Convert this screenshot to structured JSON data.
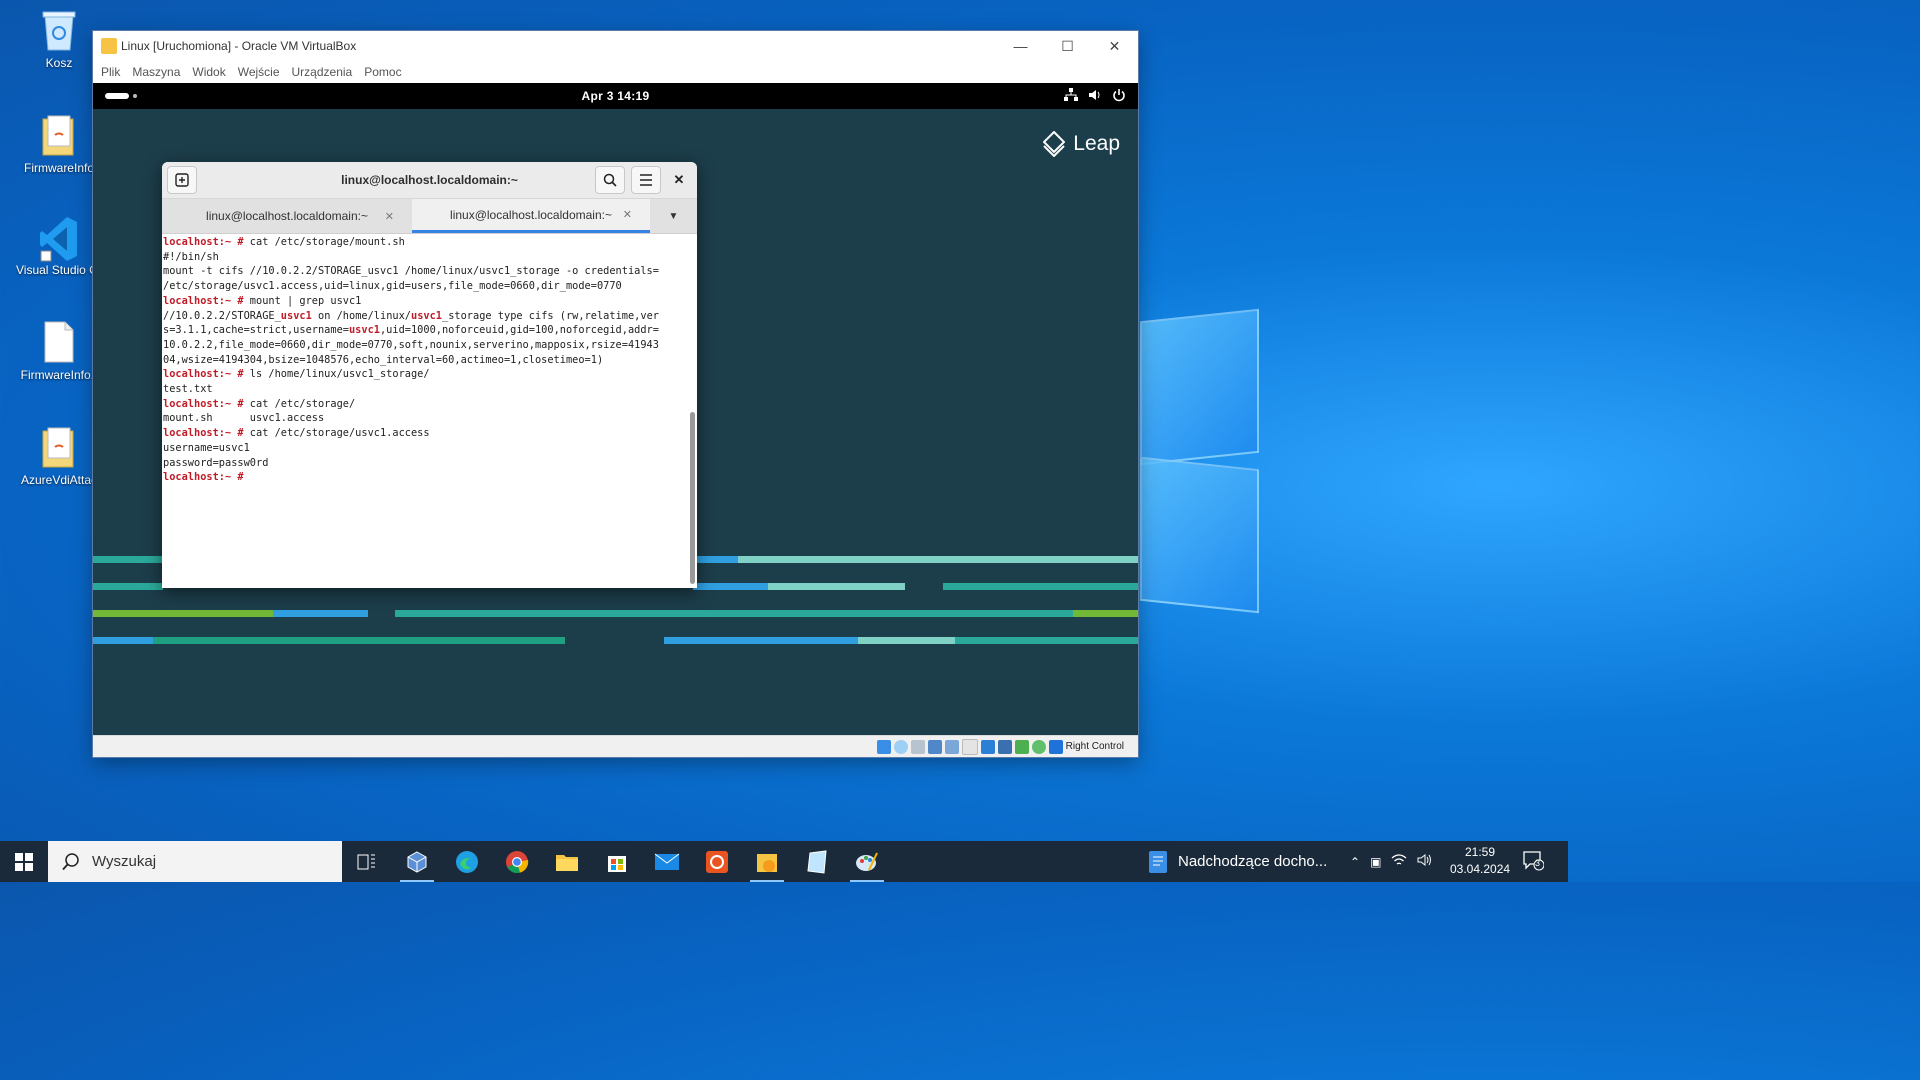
{
  "desktop": {
    "icons": [
      {
        "label": "Kosz"
      },
      {
        "label": "FirmwareInfo"
      },
      {
        "label": "Visual Studio Co"
      },
      {
        "label": "FirmwareInfo.t"
      },
      {
        "label": "AzureVdiAttac"
      }
    ]
  },
  "vbox": {
    "title": "Linux [Uruchomiona] - Oracle VM VirtualBox",
    "menu": [
      "Plik",
      "Maszyna",
      "Widok",
      "Wejście",
      "Urządzenia",
      "Pomoc"
    ],
    "host_key": "Right Control"
  },
  "gnome": {
    "clock": "Apr 3  14:19",
    "brand": "Leap"
  },
  "terminal": {
    "title": "linux@localhost.localdomain:~",
    "tabs": [
      {
        "label": "linux@localhost.localdomain:~"
      },
      {
        "label": "linux@localhost.localdomain:~"
      }
    ],
    "prompt": "localhost:~ #",
    "lines": {
      "l1_cmd": " cat /etc/storage/mount.sh",
      "l2": "#!/bin/sh",
      "l3": "mount -t cifs //10.0.2.2/STORAGE_usvc1 /home/linux/usvc1_storage -o credentials=",
      "l4": "/etc/storage/usvc1.access,uid=linux,gid=users,file_mode=0660,dir_mode=0770",
      "l5_cmd": " mount | grep usvc1",
      "l6a": "//10.0.2.2/STORAGE_",
      "hl1": "usvc1",
      "l6b": " on /home/linux/",
      "hl2": "usvc1",
      "l6c": "_storage type cifs (rw,relatime,ver",
      "l7a": "s=3.1.1,cache=strict,username=",
      "hl3": "usvc1",
      "l7b": ",uid=1000,noforceuid,gid=100,noforcegid,addr=",
      "l8": "10.0.2.2,file_mode=0660,dir_mode=0770,soft,nounix,serverino,mapposix,rsize=41943",
      "l9": "04,wsize=4194304,bsize=1048576,echo_interval=60,actimeo=1,closetimeo=1)",
      "l10_cmd": " ls /home/linux/usvc1_storage/",
      "l11": "test.txt",
      "l12_cmd": " cat /etc/storage/",
      "l13": "mount.sh      usvc1.access",
      "l14_cmd": " cat /etc/storage/usvc1.access",
      "l15": "username=usvc1",
      "l16": "password=passw0rd",
      "l17_cmd": " "
    }
  },
  "taskbar": {
    "search_placeholder": "Wyszukaj",
    "news": "Nadchodzące docho...",
    "time": "21:59",
    "date": "03.04.2024",
    "notification_count": "3"
  }
}
